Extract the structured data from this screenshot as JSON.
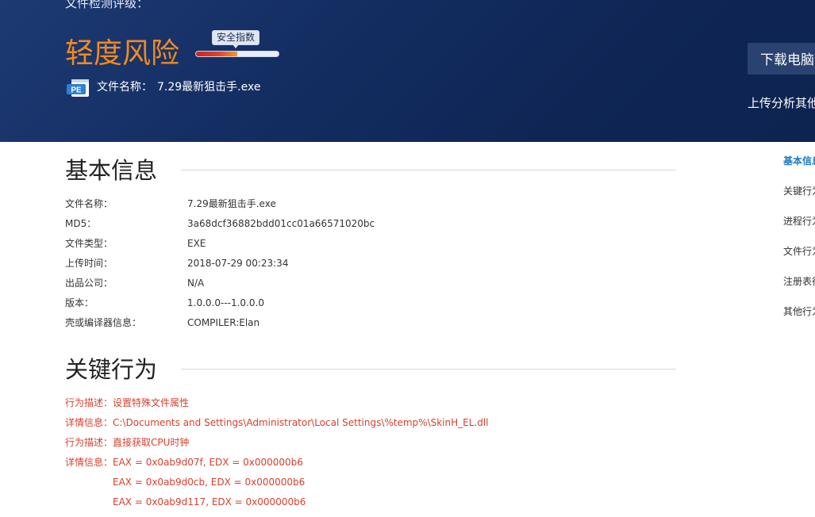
{
  "header": {
    "label": "文件检测评级：",
    "risk_level": "轻度风险",
    "gauge": {
      "label": "安全指数",
      "fill_percent": 50
    },
    "file_name_label": "文件名称：",
    "file_name": "7.29最新狙击手.exe",
    "file_icon": "pe-file-icon",
    "file_icon_text": "PE",
    "download_button": "下载电脑",
    "upload_link": "上传分析其他"
  },
  "basic_info": {
    "title": "基本信息",
    "rows": [
      {
        "key": "文件名称：",
        "value": "7.29最新狙击手.exe"
      },
      {
        "key": "MD5：",
        "value": "3a68dcf36882bdd01cc01a66571020bc"
      },
      {
        "key": "文件类型：",
        "value": "EXE"
      },
      {
        "key": "上传时间：",
        "value": "2018-07-29 00:23:34"
      },
      {
        "key": "出品公司：",
        "value": "N/A"
      },
      {
        "key": "版本：",
        "value": "1.0.0.0---1.0.0.0"
      },
      {
        "key": "壳或编译器信息：",
        "value": "COMPILER:Elan"
      }
    ]
  },
  "key_behavior": {
    "title": "关键行为",
    "rows": [
      {
        "key": "行为描述：",
        "value": "设置特殊文件属性"
      },
      {
        "key": "详情信息：",
        "value": "C:\\Documents and Settings\\Administrator\\Local Settings\\%temp%\\SkinH_EL.dll"
      },
      {
        "key": "行为描述：",
        "value": "直接获取CPU时钟"
      },
      {
        "key": "详情信息：",
        "value": "EAX = 0x0ab9d07f, EDX = 0x000000b6"
      },
      {
        "key": "",
        "value": "EAX = 0x0ab9d0cb, EDX = 0x000000b6"
      },
      {
        "key": "",
        "value": "EAX = 0x0ab9d117, EDX = 0x000000b6"
      }
    ]
  },
  "side_nav": {
    "items": [
      {
        "label": "基本信息",
        "active": true
      },
      {
        "label": "关键行为",
        "active": false
      },
      {
        "label": "进程行为",
        "active": false
      },
      {
        "label": "文件行为",
        "active": false
      },
      {
        "label": "注册表行为",
        "active": false
      },
      {
        "label": "其他行为",
        "active": false
      }
    ]
  },
  "colors": {
    "banner_bg": "#132d61",
    "risk_orange": "#f28a1e",
    "behavior_red": "#d8402f",
    "nav_active_blue": "#1a78c2"
  }
}
